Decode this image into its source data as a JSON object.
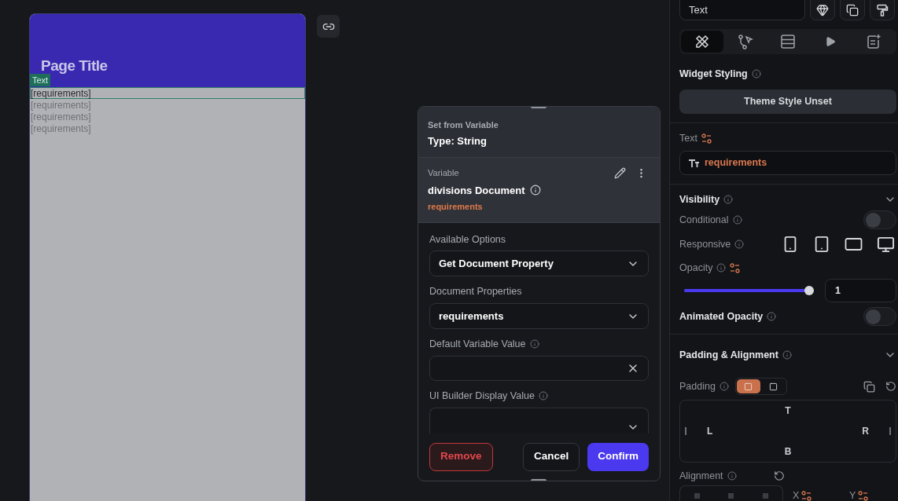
{
  "canvas": {
    "page_title": "Page Title",
    "widget_tag": "Text",
    "list_items": [
      {
        "text": "[requirements]",
        "selected": true
      },
      {
        "text": "[requirements]",
        "selected": false
      },
      {
        "text": "[requirements]",
        "selected": false
      },
      {
        "text": "[requirements]",
        "selected": false
      }
    ]
  },
  "dialog": {
    "subtitle": "Set from Variable",
    "title": "Type: String",
    "variable_label": "Variable",
    "variable_name": "divisions Document",
    "variable_field": "requirements",
    "fields": [
      {
        "label": "Available Options",
        "kind": "dropdown",
        "info": false,
        "value": "Get Document Property"
      },
      {
        "label": "Document Properties",
        "kind": "dropdown",
        "info": false,
        "value": "requirements"
      },
      {
        "label": "Default Variable Value",
        "kind": "clearable",
        "info": true
      },
      {
        "label": "UI Builder Display Value",
        "kind": "dropdown",
        "info": true
      }
    ],
    "buttons": [
      {
        "label": "Remove",
        "kind": "danger"
      },
      {
        "label": "Cancel",
        "kind": "secondary"
      },
      {
        "label": "Confirm",
        "kind": "primary"
      }
    ]
  },
  "panel": {
    "widget_name": "Text",
    "tabs": [
      {
        "selected": true
      },
      {
        "selected": false
      },
      {
        "selected": false
      },
      {
        "selected": false
      },
      {
        "selected": false
      }
    ],
    "widget_styling": {
      "title": "Widget Styling",
      "button": "Theme Style Unset"
    },
    "text_property": {
      "label": "Text",
      "value": "requirements"
    },
    "visibility": {
      "title": "Visibility",
      "conditional": {
        "label": "Conditional",
        "on": false
      },
      "responsive_label": "Responsive",
      "opacity": {
        "label": "Opacity",
        "level": 1,
        "value": "1"
      },
      "animated_opacity": {
        "label": "Animated Opacity",
        "on": false
      }
    },
    "padding": {
      "title": "Padding & Alignment",
      "padding_label": "Padding",
      "modes": [
        {
          "selected": true
        },
        {
          "selected": false
        }
      ],
      "sides": {
        "top": "T",
        "left": "L",
        "right": "R",
        "bottom": "B"
      },
      "alignment_label": "Alignment",
      "axes": [
        "X",
        "Y"
      ]
    }
  }
}
